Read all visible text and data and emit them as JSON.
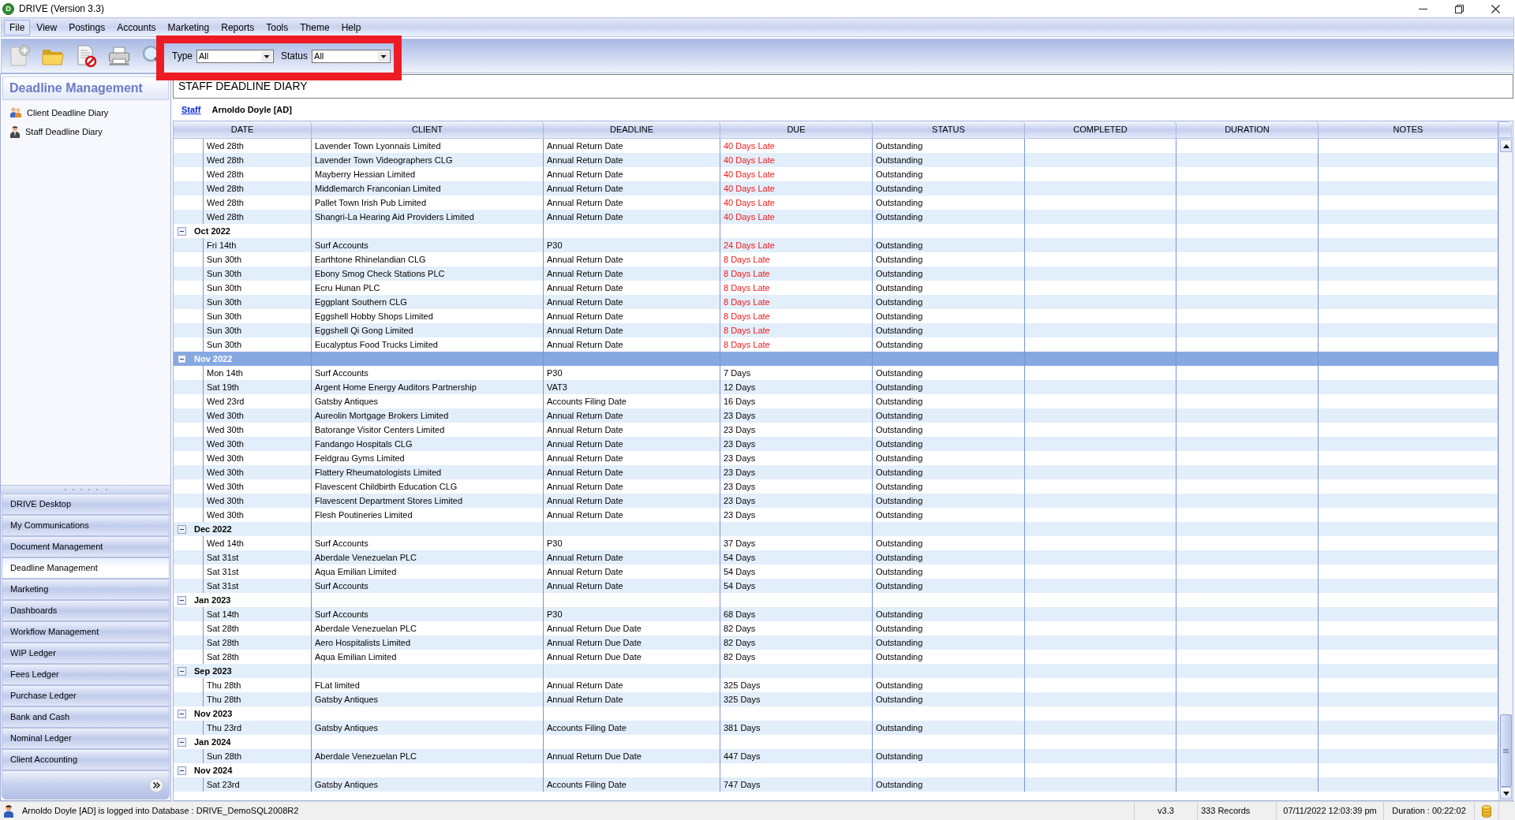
{
  "window": {
    "logo_letter": "D",
    "title": "DRIVE (Version 3.3)"
  },
  "menu": [
    {
      "label": "File",
      "highlighted": true
    },
    {
      "label": "View",
      "highlighted": false
    },
    {
      "label": "Postings",
      "highlighted": false
    },
    {
      "label": "Accounts",
      "highlighted": false
    },
    {
      "label": "Marketing",
      "highlighted": false
    },
    {
      "label": "Reports",
      "highlighted": false
    },
    {
      "label": "Tools",
      "highlighted": false
    },
    {
      "label": "Theme",
      "highlighted": false
    },
    {
      "label": "Help",
      "highlighted": false
    }
  ],
  "toolbar": {
    "filters_framed": true,
    "filters": [
      {
        "label": "Type",
        "value": "All"
      },
      {
        "label": "Status",
        "value": "All"
      }
    ]
  },
  "sidebar": {
    "title": "Deadline Management",
    "items": [
      {
        "label": "Client Deadline Diary",
        "kind": "client"
      },
      {
        "label": "Staff Deadline Diary",
        "kind": "staff"
      }
    ],
    "nav": [
      {
        "label": "DRIVE Desktop",
        "selected": false
      },
      {
        "label": "My Communications",
        "selected": false
      },
      {
        "label": "Document Management",
        "selected": false
      },
      {
        "label": "Deadline Management",
        "selected": true
      },
      {
        "label": "Marketing",
        "selected": false
      },
      {
        "label": "Dashboards",
        "selected": false
      },
      {
        "label": "Workflow Management",
        "selected": false
      },
      {
        "label": "WIP Ledger",
        "selected": false
      },
      {
        "label": "Fees Ledger",
        "selected": false
      },
      {
        "label": "Purchase Ledger",
        "selected": false
      },
      {
        "label": "Bank and Cash",
        "selected": false
      },
      {
        "label": "Nominal Ledger",
        "selected": false
      },
      {
        "label": "Client Accounting",
        "selected": false
      }
    ]
  },
  "page": {
    "title": "STAFF DEADLINE DIARY",
    "filter_link": "Staff",
    "filter_value": "Arnoldo Doyle [AD]"
  },
  "table": {
    "columns": [
      "DATE",
      "CLIENT",
      "DEADLINE",
      "DUE",
      "STATUS",
      "COMPLETED",
      "DURATION",
      "NOTES"
    ],
    "groups": [
      {
        "children": [
          {
            "date": "Wed 28th",
            "client": "Lavender Town Lyonnais Limited",
            "deadline": "Annual Return Date",
            "due": "40 Days Late",
            "overdue": true,
            "status": "Outstanding"
          },
          {
            "date": "Wed 28th",
            "client": "Lavender Town Videographers CLG",
            "deadline": "Annual Return Date",
            "due": "40 Days Late",
            "overdue": true,
            "status": "Outstanding"
          },
          {
            "date": "Wed 28th",
            "client": "Mayberry Hessian Limited",
            "deadline": "Annual Return Date",
            "due": "40 Days Late",
            "overdue": true,
            "status": "Outstanding"
          },
          {
            "date": "Wed 28th",
            "client": "Middlemarch Franconian Limited",
            "deadline": "Annual Return Date",
            "due": "40 Days Late",
            "overdue": true,
            "status": "Outstanding"
          },
          {
            "date": "Wed 28th",
            "client": "Pallet Town Irish Pub Limited",
            "deadline": "Annual Return Date",
            "due": "40 Days Late",
            "overdue": true,
            "status": "Outstanding"
          },
          {
            "date": "Wed 28th",
            "client": "Shangri-La Hearing Aid Providers Limited",
            "deadline": "Annual Return Date",
            "due": "40 Days Late",
            "overdue": true,
            "status": "Outstanding"
          }
        ]
      },
      {
        "label": "Oct 2022",
        "expanded": true,
        "selected": false,
        "children": [
          {
            "date": "Fri 14th",
            "client": "Surf Accounts",
            "deadline": "P30",
            "due": "24 Days Late",
            "overdue": true,
            "status": "Outstanding"
          },
          {
            "date": "Sun 30th",
            "client": "Earthtone Rhinelandian CLG",
            "deadline": "Annual Return Date",
            "due": "8 Days Late",
            "overdue": true,
            "status": "Outstanding"
          },
          {
            "date": "Sun 30th",
            "client": "Ebony Smog Check Stations PLC",
            "deadline": "Annual Return Date",
            "due": "8 Days Late",
            "overdue": true,
            "status": "Outstanding"
          },
          {
            "date": "Sun 30th",
            "client": "Ecru Hunan PLC",
            "deadline": "Annual Return Date",
            "due": "8 Days Late",
            "overdue": true,
            "status": "Outstanding"
          },
          {
            "date": "Sun 30th",
            "client": "Eggplant Southern CLG",
            "deadline": "Annual Return Date",
            "due": "8 Days Late",
            "overdue": true,
            "status": "Outstanding"
          },
          {
            "date": "Sun 30th",
            "client": "Eggshell Hobby Shops Limited",
            "deadline": "Annual Return Date",
            "due": "8 Days Late",
            "overdue": true,
            "status": "Outstanding"
          },
          {
            "date": "Sun 30th",
            "client": "Eggshell Qi Gong Limited",
            "deadline": "Annual Return Date",
            "due": "8 Days Late",
            "overdue": true,
            "status": "Outstanding"
          },
          {
            "date": "Sun 30th",
            "client": "Eucalyptus Food Trucks Limited",
            "deadline": "Annual Return Date",
            "due": "8 Days Late",
            "overdue": true,
            "status": "Outstanding"
          }
        ]
      },
      {
        "label": "Nov 2022",
        "expanded": true,
        "selected": true,
        "children": [
          {
            "date": "Mon 14th",
            "client": "Surf Accounts",
            "deadline": "P30",
            "due": "7 Days",
            "overdue": false,
            "status": "Outstanding"
          },
          {
            "date": "Sat 19th",
            "client": "Argent Home Energy Auditors Partnership",
            "deadline": "VAT3",
            "due": "12 Days",
            "overdue": false,
            "status": "Outstanding"
          },
          {
            "date": "Wed 23rd",
            "client": "Gatsby Antiques",
            "deadline": "Accounts Filing Date",
            "due": "16 Days",
            "overdue": false,
            "status": "Outstanding"
          },
          {
            "date": "Wed 30th",
            "client": "Aureolin Mortgage Brokers Limited",
            "deadline": "Annual Return Date",
            "due": "23 Days",
            "overdue": false,
            "status": "Outstanding"
          },
          {
            "date": "Wed 30th",
            "client": "Batorange Visitor Centers Limited",
            "deadline": "Annual Return Date",
            "due": "23 Days",
            "overdue": false,
            "status": "Outstanding"
          },
          {
            "date": "Wed 30th",
            "client": "Fandango Hospitals CLG",
            "deadline": "Annual Return Date",
            "due": "23 Days",
            "overdue": false,
            "status": "Outstanding"
          },
          {
            "date": "Wed 30th",
            "client": "Feldgrau Gyms Limited",
            "deadline": "Annual Return Date",
            "due": "23 Days",
            "overdue": false,
            "status": "Outstanding"
          },
          {
            "date": "Wed 30th",
            "client": "Flattery Rheumatologists Limited",
            "deadline": "Annual Return Date",
            "due": "23 Days",
            "overdue": false,
            "status": "Outstanding"
          },
          {
            "date": "Wed 30th",
            "client": "Flavescent Childbirth Education CLG",
            "deadline": "Annual Return Date",
            "due": "23 Days",
            "overdue": false,
            "status": "Outstanding"
          },
          {
            "date": "Wed 30th",
            "client": "Flavescent Department Stores Limited",
            "deadline": "Annual Return Date",
            "due": "23 Days",
            "overdue": false,
            "status": "Outstanding"
          },
          {
            "date": "Wed 30th",
            "client": "Flesh Poutineries Limited",
            "deadline": "Annual Return Date",
            "due": "23 Days",
            "overdue": false,
            "status": "Outstanding"
          }
        ]
      },
      {
        "label": "Dec 2022",
        "expanded": true,
        "selected": false,
        "children": [
          {
            "date": "Wed 14th",
            "client": "Surf Accounts",
            "deadline": "P30",
            "due": "37 Days",
            "overdue": false,
            "status": "Outstanding"
          },
          {
            "date": "Sat 31st",
            "client": "Aberdale Venezuelan PLC",
            "deadline": "Annual Return Date",
            "due": "54 Days",
            "overdue": false,
            "status": "Outstanding"
          },
          {
            "date": "Sat 31st",
            "client": "Aqua Emilian Limited",
            "deadline": "Annual Return Date",
            "due": "54 Days",
            "overdue": false,
            "status": "Outstanding"
          },
          {
            "date": "Sat 31st",
            "client": "Surf Accounts",
            "deadline": "Annual Return Date",
            "due": "54 Days",
            "overdue": false,
            "status": "Outstanding"
          }
        ]
      },
      {
        "label": "Jan 2023",
        "expanded": true,
        "selected": false,
        "children": [
          {
            "date": "Sat 14th",
            "client": "Surf Accounts",
            "deadline": "P30",
            "due": "68 Days",
            "overdue": false,
            "status": "Outstanding"
          },
          {
            "date": "Sat 28th",
            "client": "Aberdale Venezuelan PLC",
            "deadline": "Annual Return Due Date",
            "due": "82 Days",
            "overdue": false,
            "status": "Outstanding"
          },
          {
            "date": "Sat 28th",
            "client": "Aero Hospitalists Limited",
            "deadline": "Annual Return Due Date",
            "due": "82 Days",
            "overdue": false,
            "status": "Outstanding"
          },
          {
            "date": "Sat 28th",
            "client": "Aqua Emilian Limited",
            "deadline": "Annual Return Due Date",
            "due": "82 Days",
            "overdue": false,
            "status": "Outstanding"
          }
        ]
      },
      {
        "label": "Sep 2023",
        "expanded": true,
        "selected": false,
        "children": [
          {
            "date": "Thu 28th",
            "client": "FLat limited",
            "deadline": "Annual Return Date",
            "due": "325 Days",
            "overdue": false,
            "status": "Outstanding"
          },
          {
            "date": "Thu 28th",
            "client": "Gatsby Antiques",
            "deadline": "Annual Return Date",
            "due": "325 Days",
            "overdue": false,
            "status": "Outstanding"
          }
        ]
      },
      {
        "label": "Nov 2023",
        "expanded": true,
        "selected": false,
        "children": [
          {
            "date": "Thu 23rd",
            "client": "Gatsby Antiques",
            "deadline": "Accounts Filing Date",
            "due": "381 Days",
            "overdue": false,
            "status": "Outstanding"
          }
        ]
      },
      {
        "label": "Jan 2024",
        "expanded": true,
        "selected": false,
        "children": [
          {
            "date": "Sun 28th",
            "client": "Aberdale Venezuelan PLC",
            "deadline": "Annual Return Due Date",
            "due": "447 Days",
            "overdue": false,
            "status": "Outstanding"
          }
        ]
      },
      {
        "label": "Nov 2024",
        "expanded": true,
        "selected": false,
        "children": [
          {
            "date": "Sat 23rd",
            "client": "Gatsby Antiques",
            "deadline": "Accounts Filing Date",
            "due": "747 Days",
            "overdue": false,
            "status": "Outstanding"
          }
        ]
      }
    ]
  },
  "status_bar": {
    "message": "Arnoldo Doyle [AD] is logged into Database : DRIVE_DemoSQL2008R2",
    "version": "v3.3",
    "records": "333 Records",
    "datetime": "07/11/2022 12:03:39 pm",
    "duration": "Duration : 00:22:02"
  }
}
